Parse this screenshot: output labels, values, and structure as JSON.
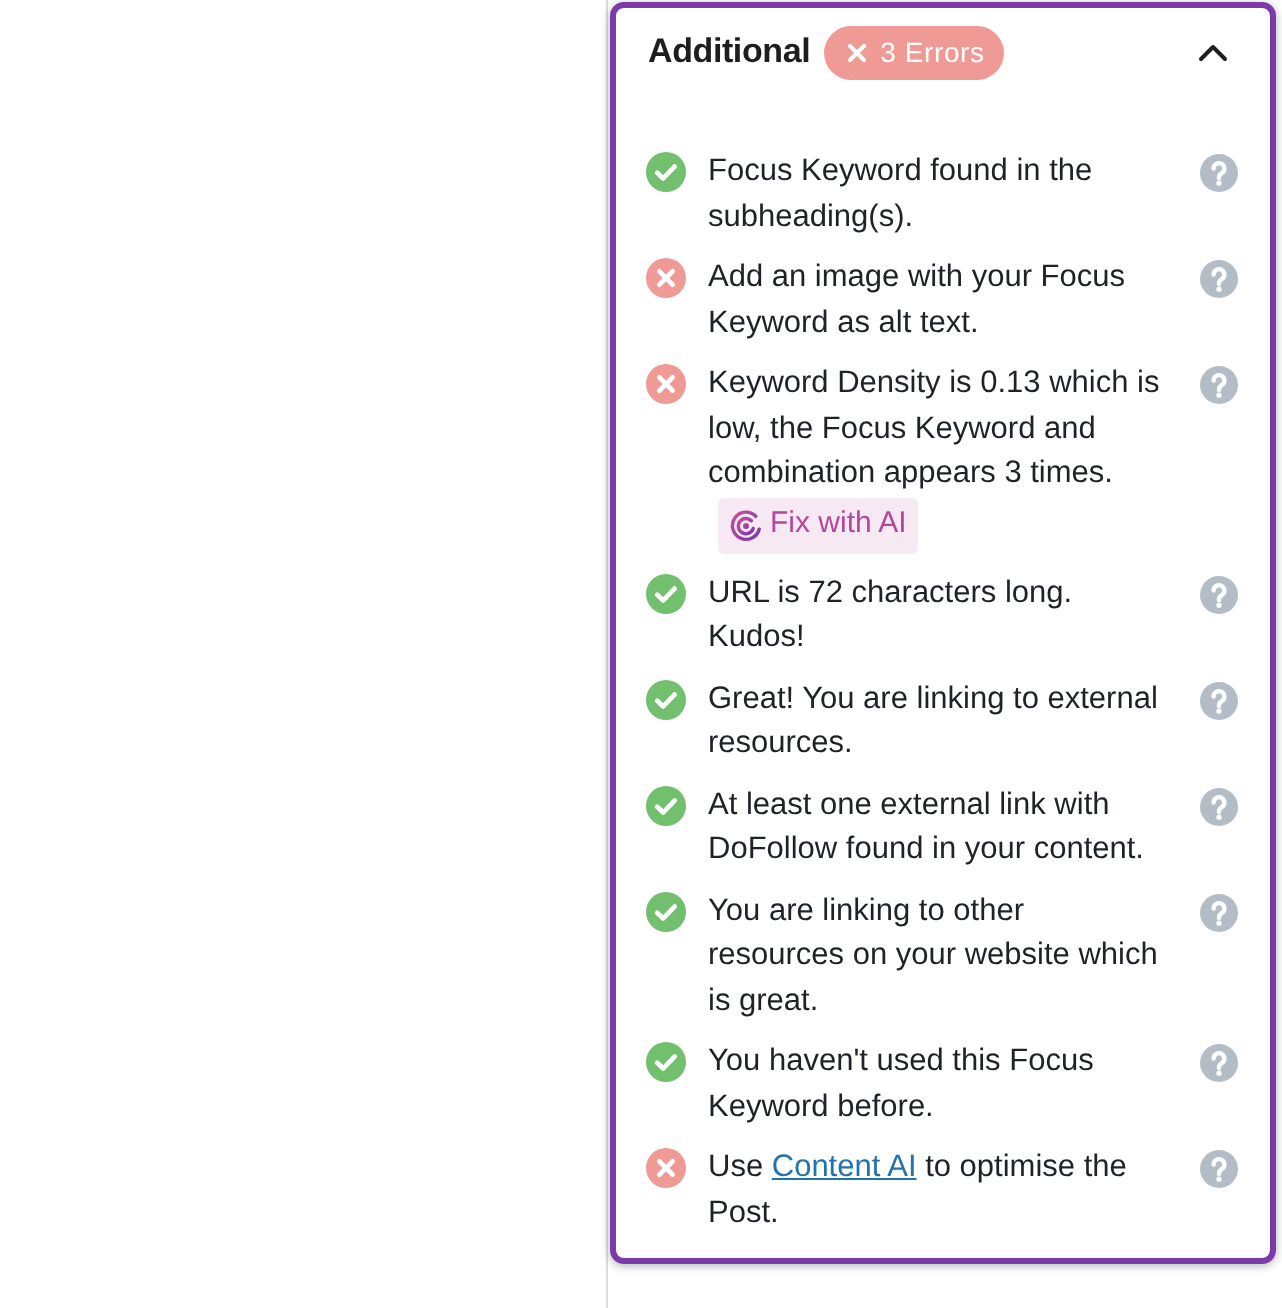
{
  "panel": {
    "title": "Additional",
    "badge": {
      "count_text": "3 Errors"
    },
    "expanded": true,
    "items": [
      {
        "passed": true,
        "text": "Focus Keyword found in the subheading(s)."
      },
      {
        "passed": false,
        "text": "Add an image with your Focus Keyword as alt text."
      },
      {
        "passed": false,
        "text": "Keyword Density is 0.13 which is low, the Focus Keyword and combination appears 3 times.",
        "action": "Fix with AI"
      },
      {
        "passed": true,
        "text": "URL is 72 characters long. Kudos!"
      },
      {
        "passed": true,
        "text": "Great! You are linking to external resources."
      },
      {
        "passed": true,
        "text": "At least one external link with DoFollow found in your content."
      },
      {
        "passed": true,
        "text": "You are linking to other resources on your website which is great."
      },
      {
        "passed": true,
        "text": "You haven't used this Focus Keyword before."
      },
      {
        "passed": false,
        "text": "Use ",
        "link": "Content AI",
        "text_after": " to optimise the Post."
      }
    ]
  }
}
